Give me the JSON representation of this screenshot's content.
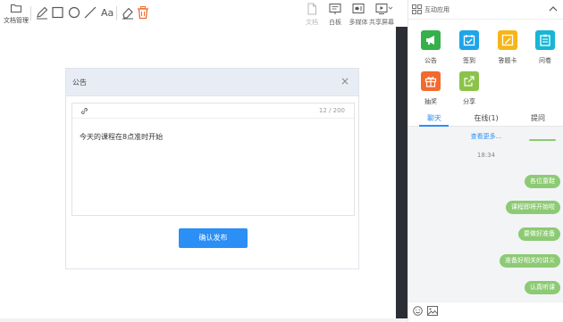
{
  "toolbar": {
    "file_manage_label": "文档管理",
    "text_tool_label": "Aa",
    "right_tools": [
      {
        "name": "document",
        "label": "文档",
        "enabled": false
      },
      {
        "name": "whiteboard",
        "label": "白板",
        "enabled": true
      },
      {
        "name": "multimedia",
        "label": "多媒体",
        "enabled": true
      },
      {
        "name": "share-screen",
        "label": "共享屏幕",
        "enabled": true
      }
    ]
  },
  "dialog": {
    "title": "公告",
    "close_glyph": "×",
    "char_count": "12 / 200",
    "content": "今天的课程在8点准时开始",
    "publish_label": "确认发布"
  },
  "panel": {
    "title": "互动应用",
    "apps": [
      {
        "label": "公告",
        "icon": "megaphone-icon",
        "color": "#35b04a"
      },
      {
        "label": "签到",
        "icon": "calendar-check-icon",
        "color": "#1fa4e8"
      },
      {
        "label": "答题卡",
        "icon": "answer-card-icon",
        "color": "#f6b619"
      },
      {
        "label": "问卷",
        "icon": "questionnaire-icon",
        "color": "#17b6d6"
      },
      {
        "label": "抽奖",
        "icon": "gift-icon",
        "color": "#f26a2e"
      },
      {
        "label": "分享",
        "icon": "share-icon",
        "color": "#8bc34a"
      }
    ],
    "tabs": [
      "聊天",
      "在线(1)",
      "提问"
    ],
    "active_tab": "聊天"
  },
  "chat": {
    "see_more": "查看更多...",
    "time": "18:34",
    "messages": [
      "各位童鞋",
      "课程即将开始啦",
      "要做好准备",
      "准备好相关的讲义",
      "认真听课"
    ]
  },
  "colors": {
    "accent": "#2b8ff5",
    "bubble": "#8dca74",
    "delete_icon": "#f26a2e",
    "canvas_border": "#2c2e36"
  }
}
